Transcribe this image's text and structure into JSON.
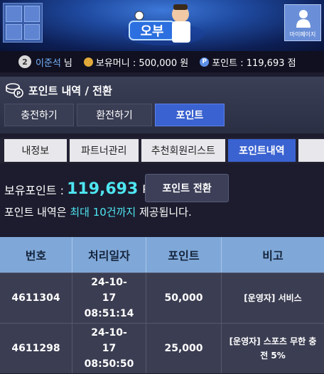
{
  "header": {
    "mypage_label": "마이페이지"
  },
  "user": {
    "level": "2",
    "name": "이준석",
    "honorific": "님",
    "money_label": "보유머니 : 500,000 원",
    "point_label": "포인트 : 119,693 점"
  },
  "section": {
    "title": "포인트 내역 / 전환"
  },
  "tabs": [
    {
      "label": "충전하기"
    },
    {
      "label": "환전하기"
    },
    {
      "label": "포인트"
    }
  ],
  "subtabs": [
    {
      "label": "내정보"
    },
    {
      "label": "파트너관리"
    },
    {
      "label": "추천회원리스트"
    },
    {
      "label": "포인트내역"
    }
  ],
  "points": {
    "label": "보유포인트 :",
    "value": "119,693",
    "unit": "P",
    "convert_button": "포인트 전환",
    "note_prefix": "포인트 내역은 ",
    "note_highlight": "최대 10건까지",
    "note_suffix": " 제공됩니다."
  },
  "table": {
    "headers": [
      "번호",
      "처리일자",
      "포인트",
      "비고"
    ],
    "rows": [
      {
        "no": "4611304",
        "date": "24-10-\n17\n08:51:14",
        "point": "50,000",
        "memo": "[운영자] 서비스"
      },
      {
        "no": "4611298",
        "date": "24-10-\n17\n08:50:50",
        "point": "25,000",
        "memo": "[운영자] 스포츠 무한 충전 5%"
      }
    ]
  },
  "colors": {
    "accent": "#3a62d0",
    "highlight": "#4ee6f1",
    "table_header": "#7fa8d8"
  }
}
